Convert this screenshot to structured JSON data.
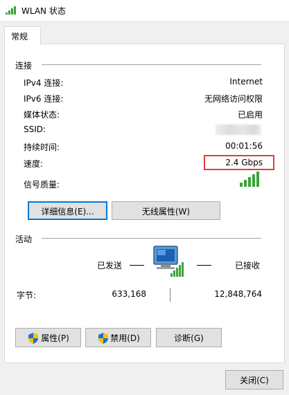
{
  "window": {
    "title": "WLAN 状态",
    "title_icon": "wifi-signal-icon"
  },
  "tabs": [
    {
      "label": "常规",
      "selected": true
    }
  ],
  "connection": {
    "header": "连接",
    "rows": [
      {
        "label": "IPv4 连接:",
        "value": "Internet"
      },
      {
        "label": "IPv6 连接:",
        "value": "无网络访问权限"
      },
      {
        "label": "媒体状态:",
        "value": "已启用"
      },
      {
        "label": "SSID:",
        "value": ""
      },
      {
        "label": "持续时间:",
        "value": "00:01:56"
      },
      {
        "label": "速度:",
        "value": "2.4 Gbps"
      }
    ],
    "signal_label": "信号质量:",
    "signal_icon": "signal-strength-icon",
    "highlight_color": "#e23b3b"
  },
  "buttons": {
    "details": "详细信息(E)...",
    "wireless_properties": "无线属性(W)",
    "properties": "属性(P)",
    "disable": "禁用(D)",
    "diagnose": "诊断(G)",
    "close": "关闭(C)"
  },
  "activity": {
    "header": "活动",
    "sent_label": "已发送",
    "received_label": "已接收",
    "bytes_label": "字节:",
    "bytes_sent": "633,168",
    "bytes_received": "12,848,764",
    "network_icon": "network-computer-icon"
  },
  "colors": {
    "focus_blue": "#0078d7",
    "signal_green": "#3aa33a"
  }
}
